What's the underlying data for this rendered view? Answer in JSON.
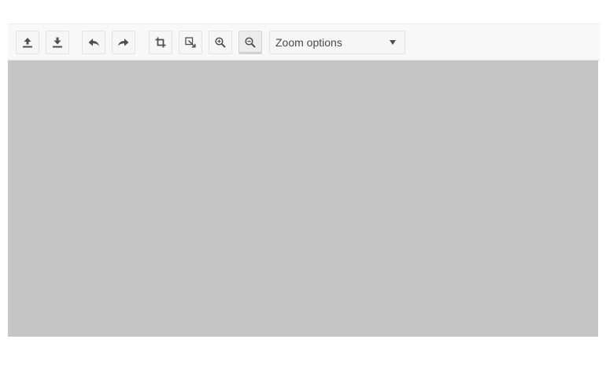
{
  "toolbar": {
    "tools": [
      {
        "icon": "upload-icon",
        "label": ""
      },
      {
        "icon": "download-icon",
        "label": ""
      },
      {
        "icon": "undo-icon",
        "label": ""
      },
      {
        "icon": "redo-icon",
        "label": ""
      },
      {
        "icon": "crop-icon",
        "label": ""
      },
      {
        "icon": "resize-icon",
        "label": ""
      },
      {
        "icon": "zoom-in-icon",
        "label": ""
      },
      {
        "icon": "zoom-out-icon",
        "label": ""
      }
    ],
    "zoom": {
      "label": "Zoom options",
      "caret_icon": "caret-down-icon"
    }
  },
  "colors": {
    "toolbar_bg": "#f8f8f8",
    "canvas_bg": "#c6c6c6",
    "icon": "#505050"
  }
}
